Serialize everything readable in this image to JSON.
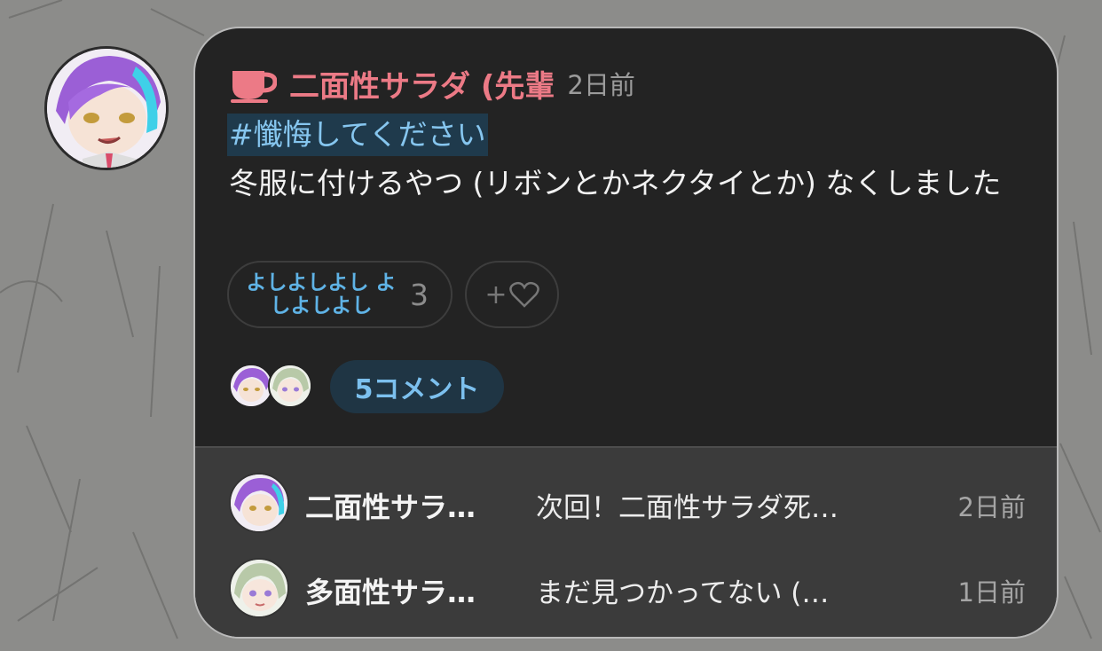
{
  "post": {
    "author": "二面性サラダ (先輩",
    "time": "2日前",
    "hashtag": "#懺悔してください",
    "body": "冬服に付けるやつ (リボンとかネクタイとか) なくしました",
    "reaction": {
      "label": "よしよしよし よしよしよし",
      "count": "3"
    },
    "add_reaction": {
      "label": "+",
      "icon": "heart-outline-icon"
    },
    "comment_button": "5コメント"
  },
  "comments": [
    {
      "author": "二面性サラ…",
      "text": "次回！二面性サラダ死…",
      "time": "2日前",
      "avatar": "purple-hair-avatar"
    },
    {
      "author": "多面性サラ…",
      "text": "まだ見つかってない (…",
      "time": "1日前",
      "avatar": "green-hair-avatar"
    }
  ],
  "colors": {
    "author": "#ec7a86",
    "hashtag_text": "#86c6ef",
    "hashtag_bg": "#1f3a4c",
    "card_bg": "#232323",
    "comments_bg": "#3b3b3b",
    "reaction_text": "#5fb3e6"
  }
}
